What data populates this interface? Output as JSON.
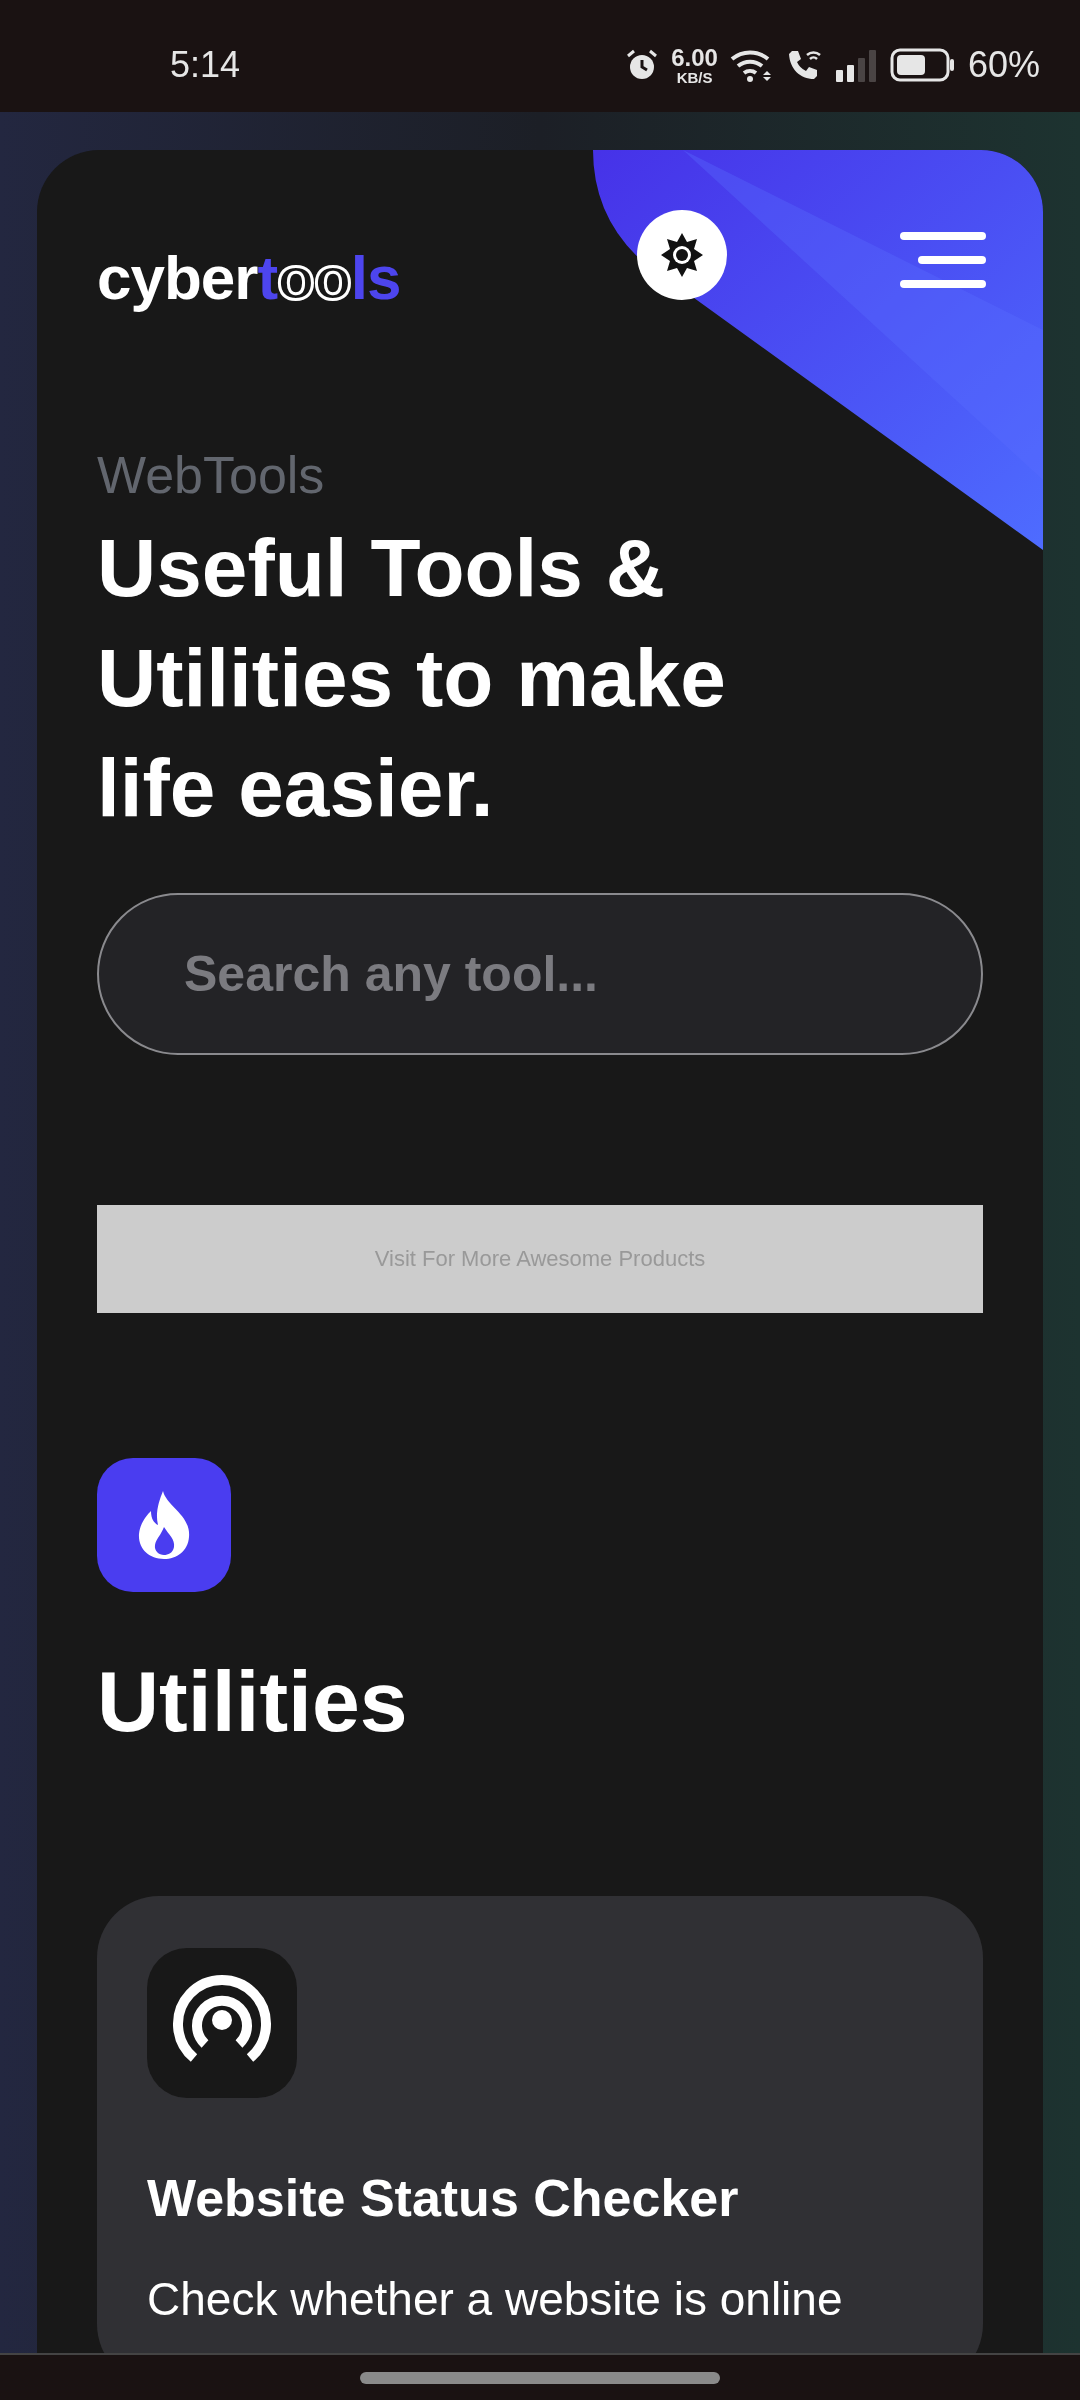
{
  "status_bar": {
    "time": "5:14",
    "speed_value": "6.00",
    "speed_unit": "KB/S",
    "battery": "60%"
  },
  "header": {
    "logo": {
      "text": "cyber",
      "accent": "tools"
    }
  },
  "hero": {
    "eyebrow": "WebTools",
    "headline": "Useful Tools & Utilities to make life easier."
  },
  "search": {
    "placeholder": "Search any tool..."
  },
  "ad_banner": {
    "text": "Visit For More Awesome Products"
  },
  "section": {
    "title": "Utilities"
  },
  "tools": [
    {
      "title": "Website Status Checker",
      "description": "Check whether a website is online"
    }
  ]
}
